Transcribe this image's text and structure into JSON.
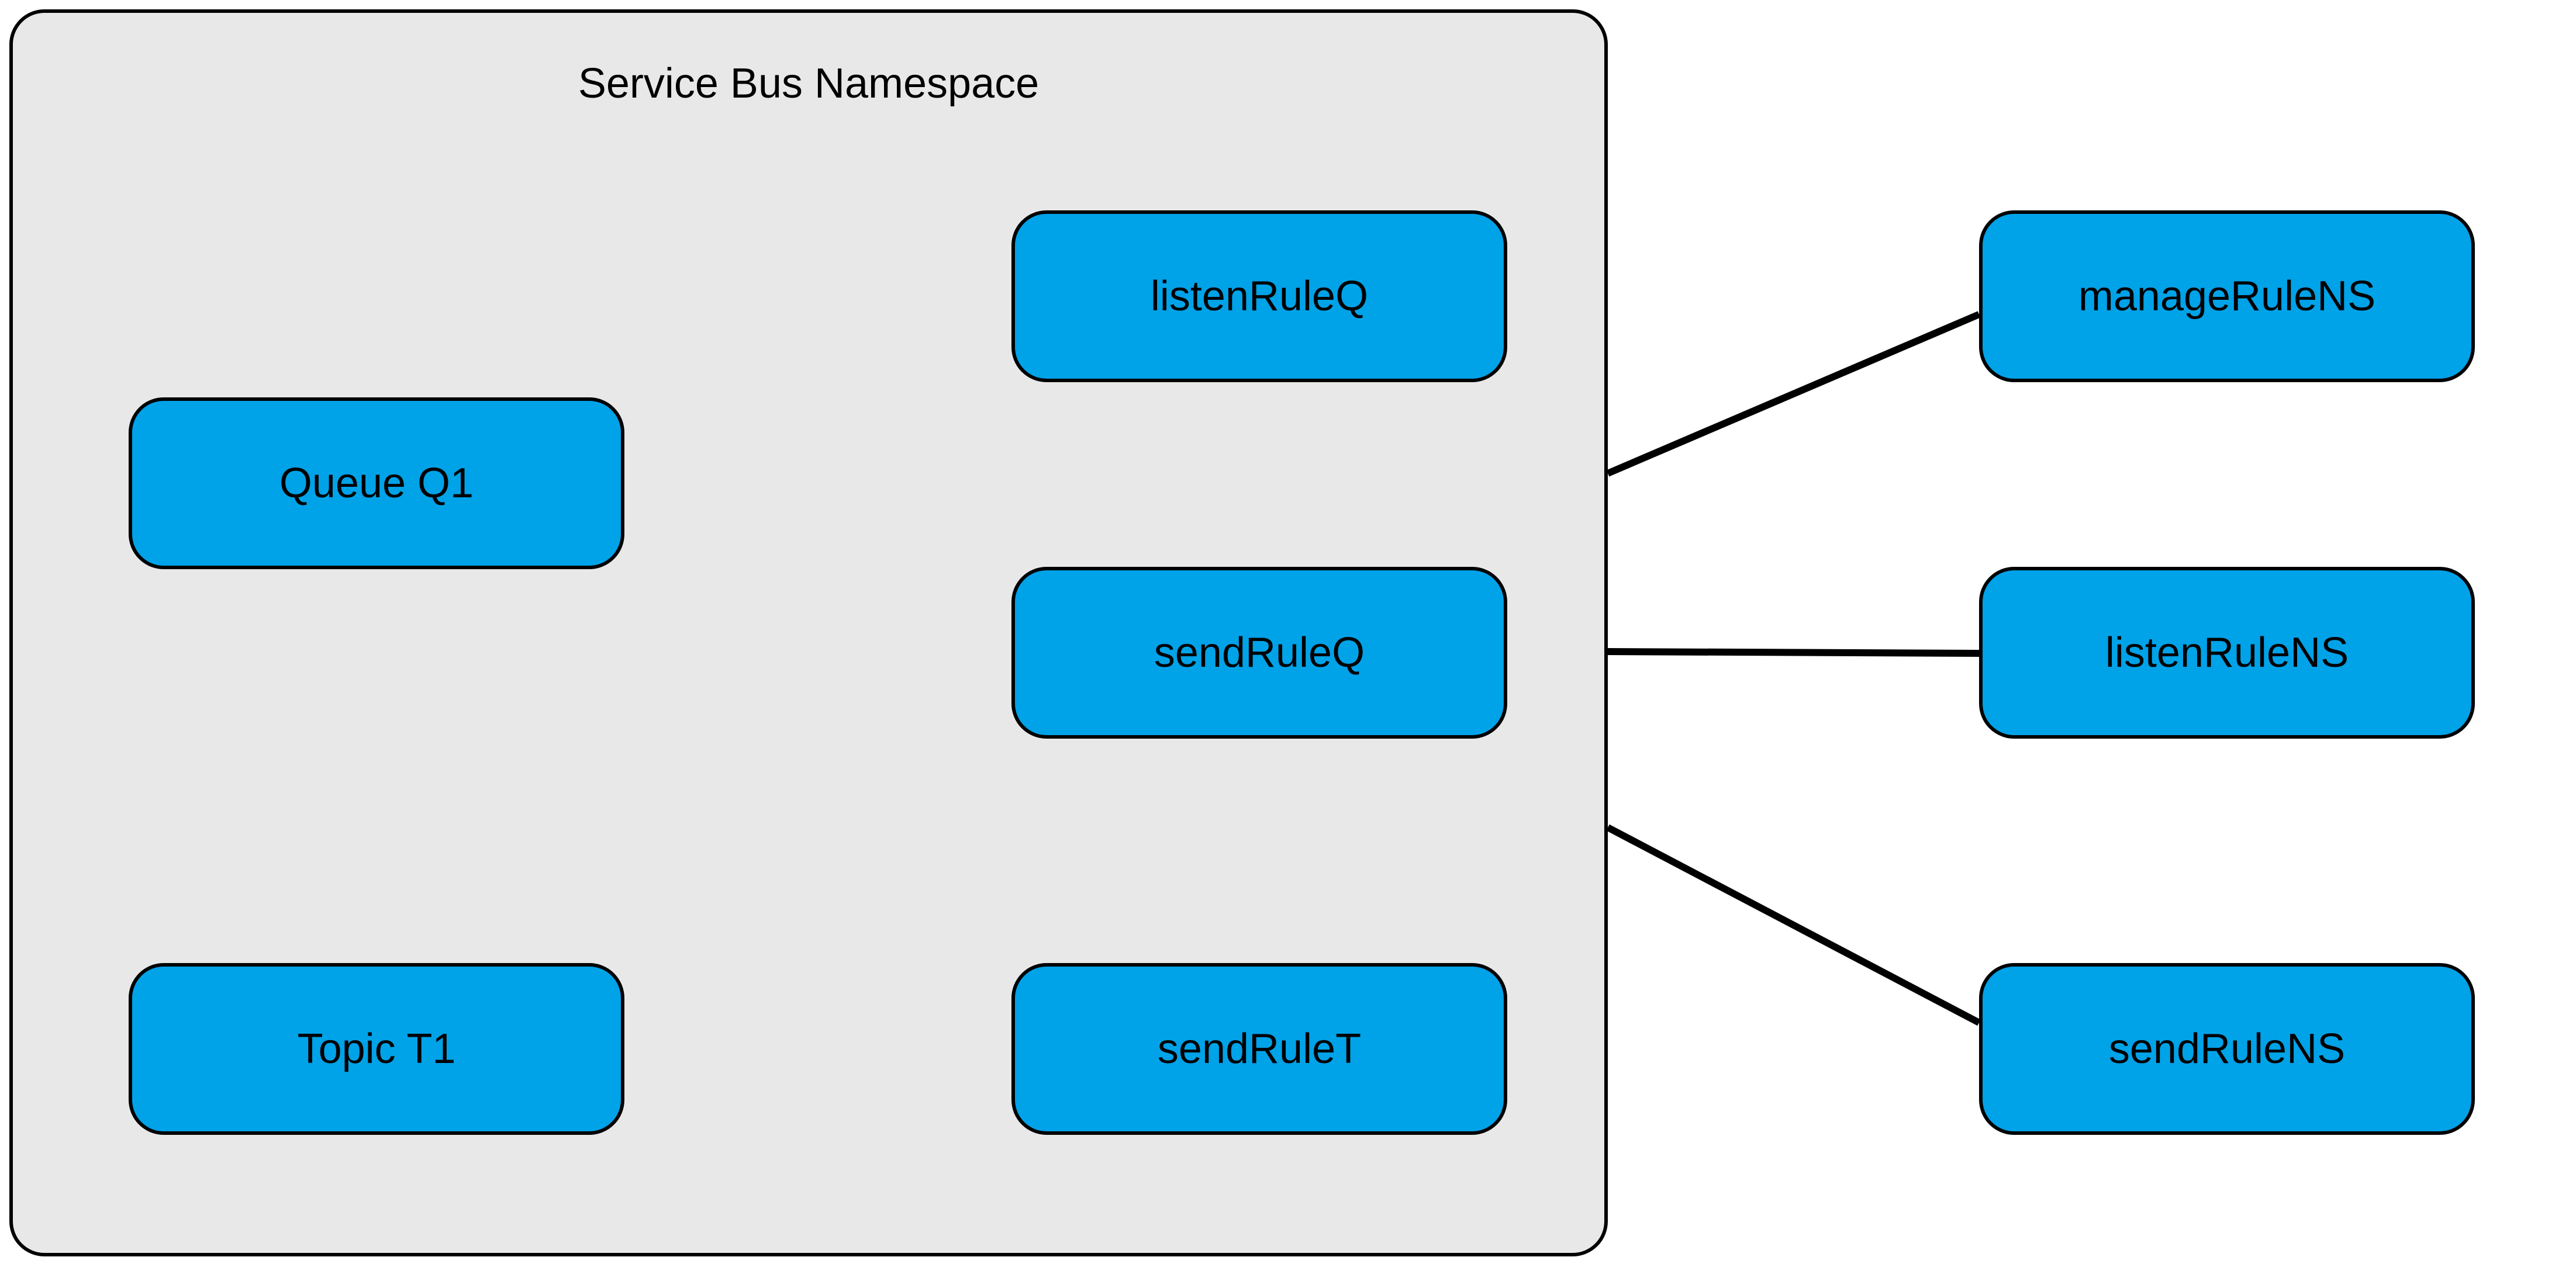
{
  "diagram": {
    "container": {
      "title": "Service Bus Namespace"
    },
    "nodes": {
      "queue_q1": "Queue Q1",
      "topic_t1": "Topic T1",
      "listen_rule_q": "listenRuleQ",
      "send_rule_q": "sendRuleQ",
      "send_rule_t": "sendRuleT",
      "manage_rule_ns": "manageRuleNS",
      "listen_rule_ns": "listenRuleNS",
      "send_rule_ns": "sendRuleNS"
    },
    "colors": {
      "node_fill": "#00a2e8",
      "container_fill": "#e8e8e8",
      "stroke": "#000000"
    },
    "edges": [
      {
        "from": "queue_q1",
        "to": "listen_rule_q"
      },
      {
        "from": "queue_q1",
        "to": "send_rule_q"
      },
      {
        "from": "topic_t1",
        "to": "send_rule_t"
      },
      {
        "from": "namespace",
        "to": "manage_rule_ns"
      },
      {
        "from": "namespace",
        "to": "listen_rule_ns"
      },
      {
        "from": "namespace",
        "to": "send_rule_ns"
      }
    ]
  }
}
